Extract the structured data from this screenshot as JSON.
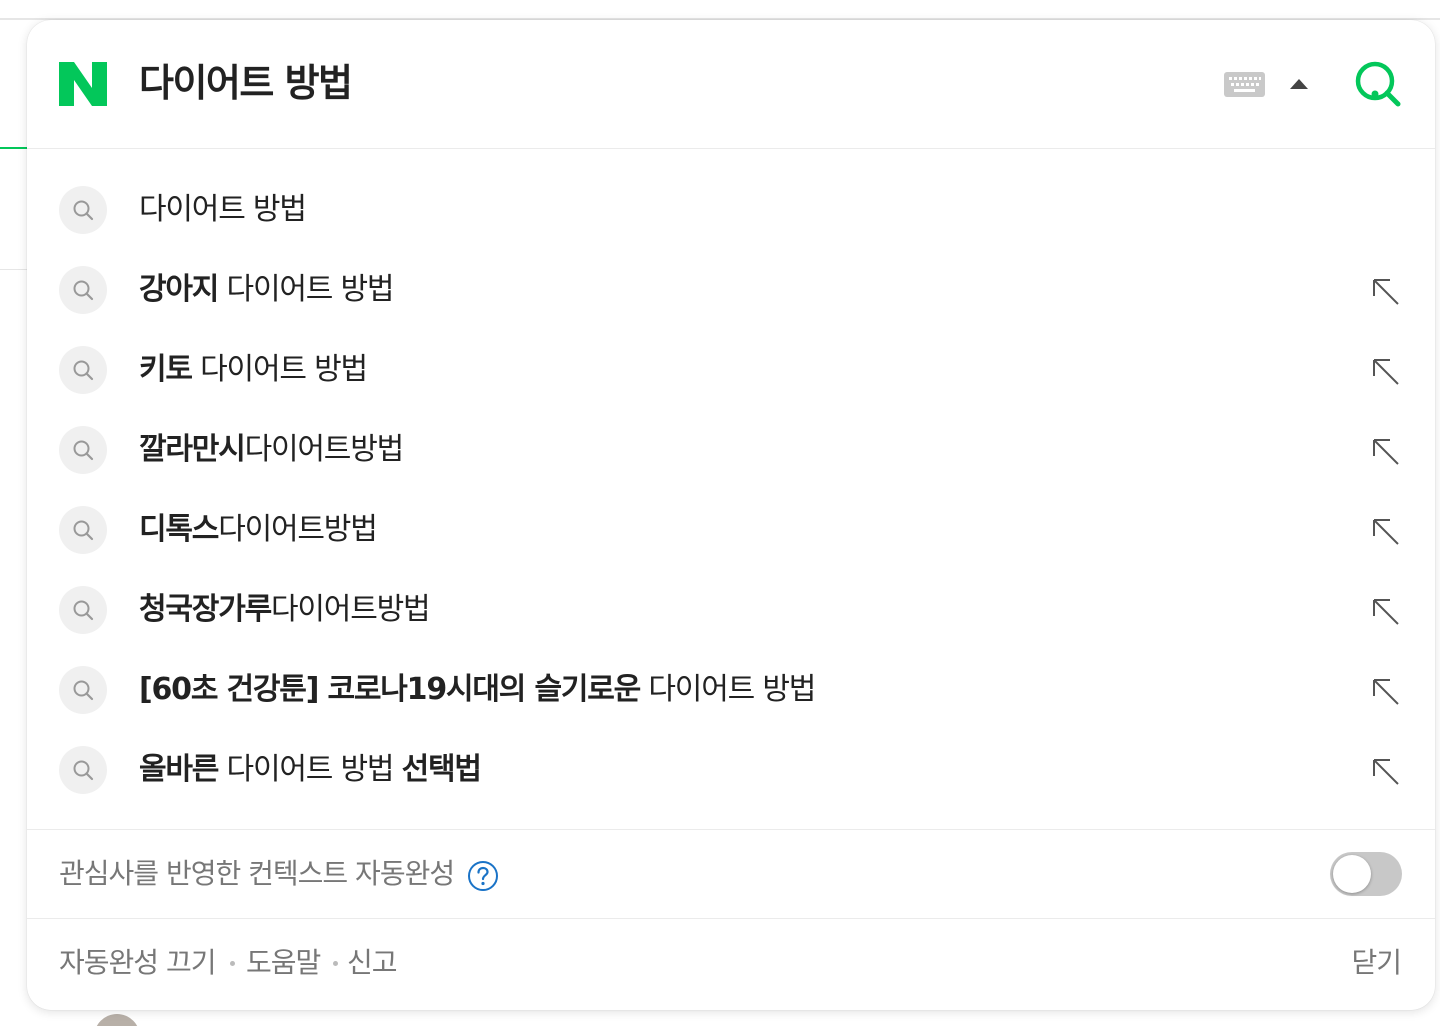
{
  "search": {
    "logo": "N",
    "query": "다이어트 방법",
    "brand_color": "#03c75a"
  },
  "icons": {
    "keyboard": "keyboard-icon",
    "collapse": "caret-up-icon",
    "search": "search-icon",
    "suggestion": "magnifier-icon",
    "fill_query": "arrow-up-left-icon",
    "help": "question-circle-icon"
  },
  "suggestions": [
    {
      "bold": "",
      "rest": "다이어트 방법",
      "after_bold": "",
      "has_arrow": false
    },
    {
      "bold": "강아지",
      "rest": " 다이어트 방법",
      "after_bold": "",
      "has_arrow": true
    },
    {
      "bold": "키토",
      "rest": " 다이어트 방법",
      "after_bold": "",
      "has_arrow": true
    },
    {
      "bold": "깔라만시",
      "rest": "다이어트방법",
      "after_bold": "",
      "has_arrow": true
    },
    {
      "bold": "디톡스",
      "rest": "다이어트방법",
      "after_bold": "",
      "has_arrow": true
    },
    {
      "bold": "청국장가루",
      "rest": "다이어트방법",
      "after_bold": "",
      "has_arrow": true
    },
    {
      "bold": "[60초 건강툰] 코로나19시대의 슬기로운",
      "rest": " 다이어트 방법",
      "after_bold": "",
      "has_arrow": true
    },
    {
      "bold": "올바른",
      "rest": " 다이어트 방법 ",
      "after_bold": "선택법",
      "has_arrow": true
    }
  ],
  "context": {
    "label": "관심사를 반영한 컨텍스트 자동완성",
    "toggle_on": false
  },
  "footer": {
    "turn_off": "자동완성 끄기",
    "help": "도움말",
    "report": "신고",
    "close": "닫기"
  }
}
